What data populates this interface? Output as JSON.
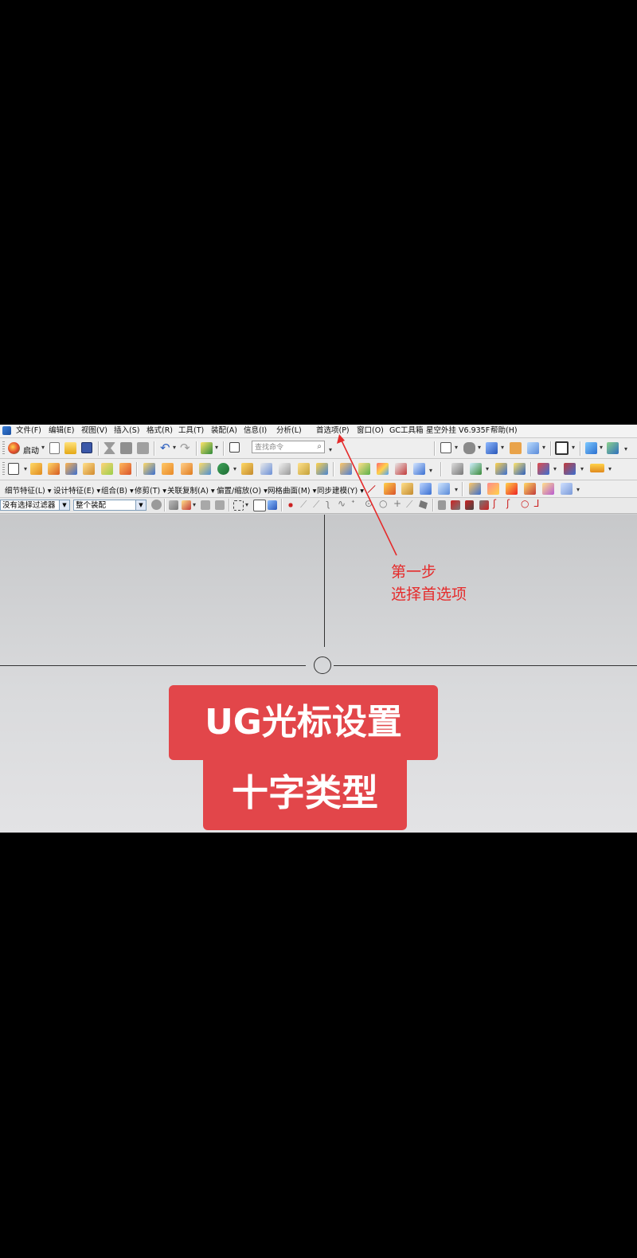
{
  "menu": {
    "items": [
      "文件(F)",
      "编辑(E)",
      "视图(V)",
      "插入(S)",
      "格式(R)",
      "工具(T)",
      "装配(A)",
      "信息(I)",
      "分析(L)",
      "首选项(P)",
      "窗口(O)",
      "GC工具箱",
      "星空外挂 V6.935F",
      "帮助(H)"
    ]
  },
  "toolbar1": {
    "start_label": "启动",
    "search_placeholder": "查找命令"
  },
  "toolbar3": {
    "items": [
      "细节特征(L) ▾",
      "设计特征(E) ▾",
      "组合(B) ▾",
      "修剪(T) ▾",
      "关联复制(A) ▾",
      "偏置/缩放(O) ▾",
      "网格曲面(M) ▾",
      "同步建模(Y) ▾"
    ]
  },
  "filterbar": {
    "type_filter": "没有选择过滤器",
    "scope_filter": "整个装配"
  },
  "annotation": {
    "line1": "第一步",
    "line2": "选择首选项",
    "color": "#e52b2b"
  },
  "banner": {
    "line1": "UG光标设置",
    "line2": "十字类型",
    "color": "#e2464a"
  }
}
